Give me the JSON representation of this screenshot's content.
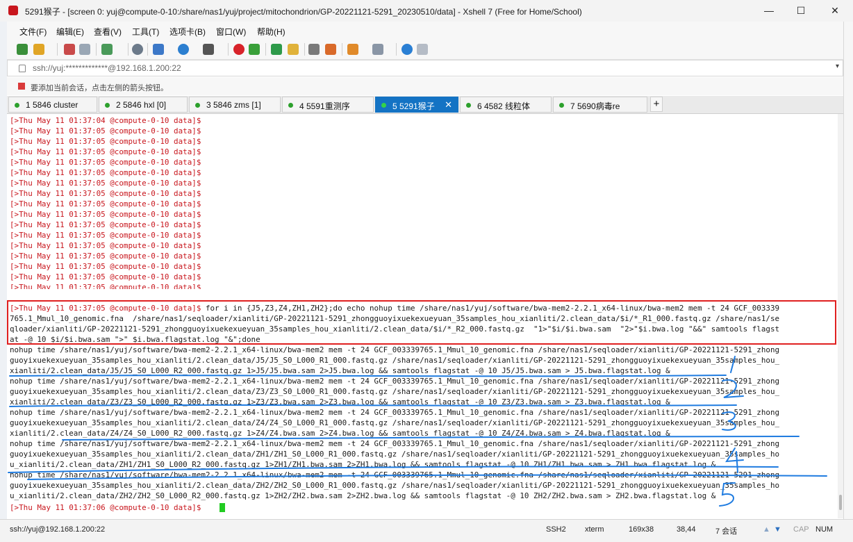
{
  "window": {
    "title": "5291猴子 - [screen 0: yuj@compute-0-10:/share/nas1/yuj/project/mitochondrion/GP-20221121-5291_20230510/data]  - Xshell 7 (Free for Home/School)",
    "minimize": "—",
    "maximize": "☐",
    "close": "✕"
  },
  "menu": [
    "文件(F)",
    "编辑(E)",
    "查看(V)",
    "工具(T)",
    "选项卡(B)",
    "窗口(W)",
    "帮助(H)"
  ],
  "address": {
    "value": "ssh://yuj:*************@192.168.1.200:22",
    "dropdown": "▾"
  },
  "hint": {
    "text": "要添加当前会话，点击左侧的箭头按钮。"
  },
  "tabs": [
    {
      "label": "1 5846 cluster",
      "active": false
    },
    {
      "label": "2 5846 hxl [0]",
      "active": false
    },
    {
      "label": "3 5846 zms [1]",
      "active": false
    },
    {
      "label": "4 5591重测序",
      "active": false
    },
    {
      "label": "5 5291猴子",
      "active": true
    },
    {
      "label": "6 4582 线粒体",
      "active": false
    },
    {
      "label": "7 5690病毒re",
      "active": false
    }
  ],
  "tab_close": "✕",
  "tab_add": "+",
  "terminal": {
    "prompt_lines": [
      "[>Thu May 11 01:37:04 @compute-0-10 data]$",
      "[>Thu May 11 01:37:05 @compute-0-10 data]$",
      "[>Thu May 11 01:37:05 @compute-0-10 data]$",
      "[>Thu May 11 01:37:05 @compute-0-10 data]$",
      "[>Thu May 11 01:37:05 @compute-0-10 data]$",
      "[>Thu May 11 01:37:05 @compute-0-10 data]$",
      "[>Thu May 11 01:37:05 @compute-0-10 data]$",
      "[>Thu May 11 01:37:05 @compute-0-10 data]$",
      "[>Thu May 11 01:37:05 @compute-0-10 data]$",
      "[>Thu May 11 01:37:05 @compute-0-10 data]$",
      "[>Thu May 11 01:37:05 @compute-0-10 data]$",
      "[>Thu May 11 01:37:05 @compute-0-10 data]$",
      "[>Thu May 11 01:37:05 @compute-0-10 data]$",
      "[>Thu May 11 01:37:05 @compute-0-10 data]$",
      "[>Thu May 11 01:37:05 @compute-0-10 data]$",
      "[>Thu May 11 01:37:05 @compute-0-10 data]$",
      "[>Thu May 11 01:37:05 @compute-0-10 data]$"
    ],
    "cmd_prompt": "[>Thu May 11 01:37:05 @compute-0-10 data]$",
    "cmd_line1": " for i in {J5,Z3,Z4,ZH1,ZH2};do echo nohup time /share/nas1/yuj/software/bwa-mem2-2.2.1_x64-linux/bwa-mem2 mem -t 24 GCF_003339",
    "cmd_line2": "765.1_Mmul_10_genomic.fna  /share/nas1/seqloader/xianliti/GP-20221121-5291_zhongguoyixuekexueyuan_35samples_hou_xianliti/2.clean_data/$i/*_R1_000.fastq.gz /share/nas1/se",
    "cmd_line3": "qloader/xianliti/GP-20221121-5291_zhongguoyixuekexueyuan_35samples_hou_xianliti/2.clean_data/$i/*_R2_000.fastq.gz  \"1>\"$i/$i.bwa.sam  \"2>\"$i.bwa.log \"&&\" samtools flagst",
    "cmd_line4": "at -@ 10 $i/$i.bwa.sam \">\" $i.bwa.flagstat.log \"&\";done",
    "output_lines": [
      "nohup time /share/nas1/yuj/software/bwa-mem2-2.2.1_x64-linux/bwa-mem2 mem -t 24 GCF_003339765.1_Mmul_10_genomic.fna /share/nas1/seqloader/xianliti/GP-20221121-5291_zhong",
      "guoyixuekexueyuan_35samples_hou_xianliti/2.clean_data/J5/J5_S0_L000_R1_000.fastq.gz /share/nas1/seqloader/xianliti/GP-20221121-5291_zhongguoyixuekexueyuan_35samples_hou_",
      "xianliti/2.clean_data/J5/J5_S0_L000_R2_000.fastq.gz 1>J5/J5.bwa.sam 2>J5.bwa.log && samtools flagstat -@ 10 J5/J5.bwa.sam > J5.bwa.flagstat.log &",
      "nohup time /share/nas1/yuj/software/bwa-mem2-2.2.1_x64-linux/bwa-mem2 mem -t 24 GCF_003339765.1_Mmul_10_genomic.fna /share/nas1/seqloader/xianliti/GP-20221121-5291_zhong",
      "guoyixuekexueyuan_35samples_hou_xianliti/2.clean_data/Z3/Z3_S0_L000_R1_000.fastq.gz /share/nas1/seqloader/xianliti/GP-20221121-5291_zhongguoyixuekexueyuan_35samples_hou_",
      "xianliti/2.clean_data/Z3/Z3_S0_L000_R2_000.fastq.gz 1>Z3/Z3.bwa.sam 2>Z3.bwa.log && samtools flagstat -@ 10 Z3/Z3.bwa.sam > Z3.bwa.flagstat.log &",
      "nohup time /share/nas1/yuj/software/bwa-mem2-2.2.1_x64-linux/bwa-mem2 mem -t 24 GCF_003339765.1_Mmul_10_genomic.fna /share/nas1/seqloader/xianliti/GP-20221121-5291_zhong",
      "guoyixuekexueyuan_35samples_hou_xianliti/2.clean_data/Z4/Z4_S0_L000_R1_000.fastq.gz /share/nas1/seqloader/xianliti/GP-20221121-5291_zhongguoyixuekexueyuan_35samples_hou_",
      "xianliti/2.clean_data/Z4/Z4_S0_L000_R2_000.fastq.gz 1>Z4/Z4.bwa.sam 2>Z4.bwa.log && samtools flagstat -@ 10 Z4/Z4.bwa.sam > Z4.bwa.flagstat.log &",
      "nohup time /share/nas1/yuj/software/bwa-mem2-2.2.1_x64-linux/bwa-mem2 mem -t 24 GCF_003339765.1_Mmul_10_genomic.fna /share/nas1/seqloader/xianliti/GP-20221121-5291_zhong",
      "guoyixuekexueyuan_35samples_hou_xianliti/2.clean_data/ZH1/ZH1_S0_L000_R1_000.fastq.gz /share/nas1/seqloader/xianliti/GP-20221121-5291_zhongguoyixuekexueyuan_35samples_ho",
      "u_xianliti/2.clean_data/ZH1/ZH1_S0_L000_R2_000.fastq.gz 1>ZH1/ZH1.bwa.sam 2>ZH1.bwa.log && samtools flagstat -@ 10 ZH1/ZH1.bwa.sam > ZH1.bwa.flagstat.log &",
      "nohup time /share/nas1/yuj/software/bwa-mem2-2.2.1_x64-linux/bwa-mem2 mem -t 24 GCF_003339765.1_Mmul_10_genomic.fna /share/nas1/seqloader/xianliti/GP-20221121-5291_zhong",
      "guoyixuekexueyuan_35samples_hou_xianliti/2.clean_data/ZH2/ZH2_S0_L000_R1_000.fastq.gz /share/nas1/seqloader/xianliti/GP-20221121-5291_zhongguoyixuekexueyuan_35samples_ho",
      "u_xianliti/2.clean_data/ZH2/ZH2_S0_L000_R2_000.fastq.gz 1>ZH2/ZH2.bwa.sam 2>ZH2.bwa.log && samtools flagstat -@ 10 ZH2/ZH2.bwa.sam > ZH2.bwa.flagstat.log &"
    ],
    "final_prompt": "[>Thu May 11 01:37:06 @compute-0-10 data]$"
  },
  "status": {
    "connection": "ssh://yuj@192.168.1.200:22",
    "protocol": "SSH2",
    "term": "xterm",
    "size": "169x38",
    "cursor_pos": "38,44",
    "sessions": "7 会话",
    "caps": "CAP",
    "num": "NUM"
  },
  "colors": {
    "prompt": "#c8161d",
    "active_tab": "#1473c4",
    "cursor": "#22cc22",
    "annotation_box": "#e02020",
    "annotation_ink": "#1e7be0"
  }
}
